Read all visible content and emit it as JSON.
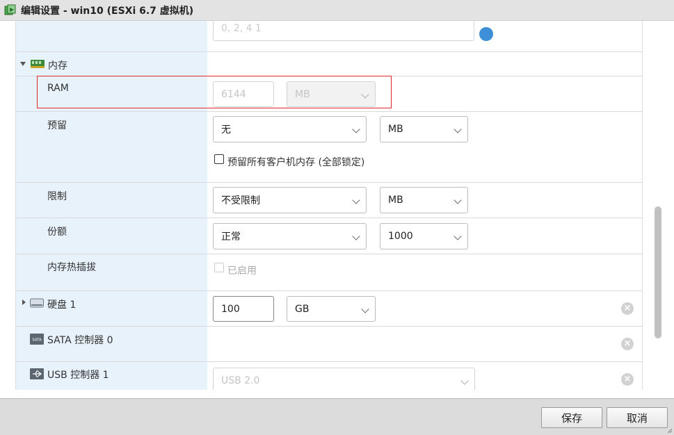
{
  "window": {
    "title": "编辑设置 - win10 (ESXi 6.7 虚拟机)"
  },
  "top_cut_row": {
    "value": "0, 2, 4 1"
  },
  "memory": {
    "section_label": "内存",
    "ram": {
      "label": "RAM",
      "value": "6144",
      "unit": "MB"
    },
    "reservation": {
      "label": "预留",
      "value": "无",
      "unit": "MB",
      "checkbox_label": "预留所有客户机内存 (全部锁定)",
      "checked": false
    },
    "limit": {
      "label": "限制",
      "value": "不受限制",
      "unit": "MB"
    },
    "shares": {
      "label": "份额",
      "value": "正常",
      "number": "1000"
    },
    "hotplug": {
      "label": "内存热插拔",
      "checkbox_label": "已启用",
      "checked": false
    }
  },
  "hard_disk": {
    "label": "硬盘 1",
    "value": "100",
    "unit": "GB"
  },
  "sata": {
    "label": "SATA 控制器 0",
    "icon_text": "SATA"
  },
  "usb": {
    "label": "USB 控制器 1",
    "value": "USB 2.0"
  },
  "footer": {
    "save": "保存",
    "cancel": "取消"
  },
  "colors": {
    "label_column": "#e8f2fb",
    "highlight": "#e02a2a",
    "info": "#3d8fd8"
  }
}
